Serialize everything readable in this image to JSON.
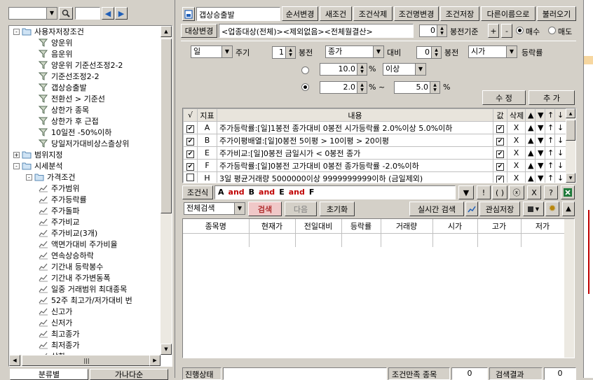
{
  "left_panel": {
    "combo_value": "",
    "search_text": "",
    "tree": [
      {
        "label": "사용자저장조건",
        "level": 0,
        "type": "folder",
        "expander": "-"
      },
      {
        "label": "양운위",
        "level": 2,
        "type": "cond"
      },
      {
        "label": "음운위",
        "level": 2,
        "type": "cond"
      },
      {
        "label": "양운위 기준선조정2-2",
        "level": 2,
        "type": "cond"
      },
      {
        "label": "기준선조정2-2",
        "level": 2,
        "type": "cond"
      },
      {
        "label": "갭상승출발",
        "level": 2,
        "type": "cond"
      },
      {
        "label": "전환선 > 기준선",
        "level": 2,
        "type": "cond"
      },
      {
        "label": "상한가 종목",
        "level": 2,
        "type": "cond"
      },
      {
        "label": "상한가 후 근접",
        "level": 2,
        "type": "cond"
      },
      {
        "label": "10일전 -50%이하",
        "level": 2,
        "type": "cond"
      },
      {
        "label": "당일저가대비상스츨상위",
        "level": 2,
        "type": "cond"
      },
      {
        "label": "범위지정",
        "level": 0,
        "type": "folder",
        "expander": "+"
      },
      {
        "label": "시세분석",
        "level": 0,
        "type": "folder",
        "expander": "-"
      },
      {
        "label": "가격조건",
        "level": 1,
        "type": "folder",
        "expander": "-"
      },
      {
        "label": "주가범위",
        "level": 2,
        "type": "chart"
      },
      {
        "label": "주가등락률",
        "level": 2,
        "type": "chart"
      },
      {
        "label": "주가돌파",
        "level": 2,
        "type": "chart"
      },
      {
        "label": "주가비교",
        "level": 2,
        "type": "chart"
      },
      {
        "label": "주가비교(3개)",
        "level": 2,
        "type": "chart"
      },
      {
        "label": "액면가대비 주가비율",
        "level": 2,
        "type": "chart"
      },
      {
        "label": "연속상승하락",
        "level": 2,
        "type": "chart"
      },
      {
        "label": "기간내 등락봉수",
        "level": 2,
        "type": "chart"
      },
      {
        "label": "기간내 주가변동폭",
        "level": 2,
        "type": "chart"
      },
      {
        "label": "일중 거래범위 최대종목",
        "level": 2,
        "type": "chart"
      },
      {
        "label": "52주 최고가/저가대비 번",
        "level": 2,
        "type": "chart"
      },
      {
        "label": "신고가",
        "level": 2,
        "type": "chart"
      },
      {
        "label": "신저가",
        "level": 2,
        "type": "chart"
      },
      {
        "label": "최고종가",
        "level": 2,
        "type": "chart"
      },
      {
        "label": "최저종가",
        "level": 2,
        "type": "chart"
      },
      {
        "label": "상한",
        "level": 2,
        "type": "chart"
      }
    ],
    "bottom_tabs": [
      "분류별",
      "가나다순"
    ]
  },
  "toolbar": {
    "condition_name": "갭상승출발",
    "buttons": [
      "순서변경",
      "새조건",
      "조건삭제",
      "조건명변경",
      "조건저장",
      "다른이름으로",
      "불러오기"
    ]
  },
  "target_bar": {
    "change_button": "대상변경",
    "target_text": "<업종대상(전체)><제외없음><전체월결산>",
    "spin_value": "0",
    "basis_label": "봉전기준",
    "plus": "+",
    "minus": "-",
    "buy_label": "매수",
    "sell_label": "매도"
  },
  "settings": {
    "period": "일",
    "period_label": "주기",
    "n1": "1",
    "n1_label": "봉전",
    "price1": "종가",
    "compare_label": "대비",
    "n2": "0",
    "n2_label": "봉전",
    "price2": "시가",
    "rate_label": "등락률",
    "opt1_value": "10.0",
    "opt1_pct": "%",
    "opt1_cond": "이상",
    "opt2_from": "2.0",
    "opt2_sep": "% ~",
    "opt2_to": "5.0",
    "opt2_pct": "%",
    "modify_button": "수  정",
    "add_button": "추  가"
  },
  "condition_table": {
    "headers": [
      "√",
      "지표",
      "내용",
      "값",
      "삭제",
      "▲",
      "▼",
      "↑",
      "↓"
    ],
    "rows": [
      {
        "checked": "✔",
        "id": "A",
        "content": "주가등락률:[일]1봉전 종가대비 0봉전 시가등락률 2.0%이상 5.0%이하",
        "val": "✔",
        "del": "X"
      },
      {
        "checked": "✔",
        "id": "B",
        "content": "주가이평배열:[일]0봉전 5이평 > 10이평 > 20이평",
        "val": "✔",
        "del": "X"
      },
      {
        "checked": "✔",
        "id": "E",
        "content": "주가비교:[일]0봉전 금일시가 < 0봉전 종가",
        "val": "✔",
        "del": "X"
      },
      {
        "checked": "✔",
        "id": "F",
        "content": "주가등락률:[일]0봉전 고가대비 0봉전 종가등락률 -2.0%이하",
        "val": "✔",
        "del": "X"
      },
      {
        "checked": "",
        "id": "H",
        "content": "3일 평균거래량 5000000이상 9999999999이하 (금일제외)",
        "val": "✔",
        "del": "X"
      }
    ],
    "arrows": [
      "▲",
      "▼",
      "↑",
      "↓"
    ]
  },
  "formula": {
    "label": "조건식",
    "tokens": [
      {
        "t": "A",
        "op": false
      },
      {
        "t": "and",
        "op": true
      },
      {
        "t": "B",
        "op": false
      },
      {
        "t": "and",
        "op": true
      },
      {
        "t": "E",
        "op": false
      },
      {
        "t": "and",
        "op": true
      },
      {
        "t": "F",
        "op": false
      }
    ],
    "buttons": [
      "▼",
      "!",
      "( )",
      "ⓧ",
      "X",
      "?"
    ]
  },
  "search_bar": {
    "scope": "전체검색",
    "search": "검색",
    "next": "다음",
    "reset": "초기화",
    "realtime": "실시간 검색",
    "watch_save": "관심저장"
  },
  "result_table": {
    "headers": [
      "종목명",
      "현재가",
      "전일대비",
      "등락률",
      "거래량",
      "시가",
      "고가",
      "저가"
    ]
  },
  "status_bar": {
    "progress_label": "진행상태",
    "matched_label": "조건만족 종목",
    "matched_count": "0",
    "result_label": "검색결과",
    "result_count": "0"
  },
  "colors": {
    "face": "#d4d0c8",
    "header": "#e8e4dc",
    "operator": "#c00000",
    "accent": "#1f5fb8",
    "search_btn": "#f0c8c8"
  }
}
